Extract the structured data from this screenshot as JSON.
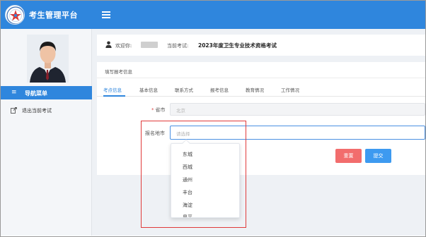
{
  "app": {
    "title": "考生管理平台"
  },
  "sidebar": {
    "nav_menu_label": "导航菜单",
    "items": [
      {
        "label": "退出当前考试",
        "icon": "exit-icon"
      }
    ]
  },
  "header": {
    "welcome_label": "欢迎你:",
    "current_exam_label": "当前考试:",
    "current_exam_name": "2023年度卫生专业技术资格考试"
  },
  "form": {
    "section_title": "填写报考信息",
    "tabs": [
      {
        "label": "考点信息",
        "active": true
      },
      {
        "label": "基本信息",
        "active": false
      },
      {
        "label": "联系方式",
        "active": false
      },
      {
        "label": "报考信息",
        "active": false
      },
      {
        "label": "教育情况",
        "active": false
      },
      {
        "label": "工作情况",
        "active": false
      }
    ],
    "province": {
      "label": "省市",
      "required_mark": "*",
      "placeholder": "北京"
    },
    "city": {
      "label": "报名地市",
      "placeholder": "请选择",
      "options": [
        "东城",
        "西城",
        "通州",
        "丰台",
        "海淀",
        "昌平"
      ]
    },
    "buttons": {
      "reset": "重置",
      "submit": "提交"
    }
  },
  "colors": {
    "primary": "#2f86dd",
    "reset_button": "#f26d6d",
    "submit_button": "#3d9af0",
    "highlight": "#e03b3b"
  }
}
